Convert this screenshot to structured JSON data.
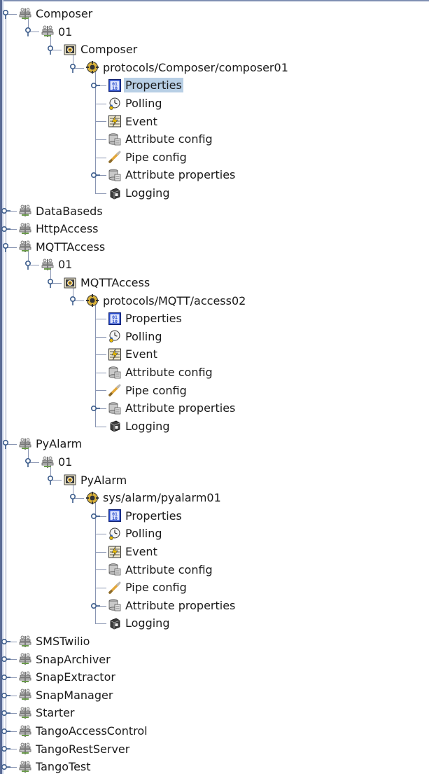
{
  "tree": {
    "rows": [
      {
        "depth": 0,
        "label": "Composer",
        "icon": "server-class-icon",
        "state": "expanded"
      },
      {
        "depth": 1,
        "label": "01",
        "icon": "server-class-icon",
        "state": "expanded"
      },
      {
        "depth": 2,
        "label": "Composer",
        "icon": "device-class-icon",
        "state": "expanded"
      },
      {
        "depth": 3,
        "label": "protocols/Composer/composer01",
        "icon": "device-icon",
        "state": "expanded"
      },
      {
        "depth": 4,
        "label": "Properties",
        "icon": "properties-icon",
        "state": "collapsed",
        "selected": true
      },
      {
        "depth": 4,
        "label": "Polling",
        "icon": "polling-icon",
        "state": "leaf"
      },
      {
        "depth": 4,
        "label": "Event",
        "icon": "event-icon",
        "state": "leaf"
      },
      {
        "depth": 4,
        "label": "Attribute config",
        "icon": "attribute-config-icon",
        "state": "leaf"
      },
      {
        "depth": 4,
        "label": "Pipe config",
        "icon": "pipe-config-icon",
        "state": "leaf"
      },
      {
        "depth": 4,
        "label": "Attribute properties",
        "icon": "attribute-config-icon",
        "state": "collapsed"
      },
      {
        "depth": 4,
        "label": "Logging",
        "icon": "logging-icon",
        "state": "leaf",
        "last": true
      },
      {
        "depth": 0,
        "label": "DataBaseds",
        "icon": "server-class-icon",
        "state": "collapsed"
      },
      {
        "depth": 0,
        "label": "HttpAccess",
        "icon": "server-class-icon",
        "state": "collapsed"
      },
      {
        "depth": 0,
        "label": "MQTTAccess",
        "icon": "server-class-icon",
        "state": "expanded"
      },
      {
        "depth": 1,
        "label": "01",
        "icon": "server-class-icon",
        "state": "expanded"
      },
      {
        "depth": 2,
        "label": "MQTTAccess",
        "icon": "device-class-icon",
        "state": "expanded"
      },
      {
        "depth": 3,
        "label": "protocols/MQTT/access02",
        "icon": "device-icon",
        "state": "expanded"
      },
      {
        "depth": 4,
        "label": "Properties",
        "icon": "properties-icon",
        "state": "leaf"
      },
      {
        "depth": 4,
        "label": "Polling",
        "icon": "polling-icon",
        "state": "leaf"
      },
      {
        "depth": 4,
        "label": "Event",
        "icon": "event-icon",
        "state": "leaf"
      },
      {
        "depth": 4,
        "label": "Attribute config",
        "icon": "attribute-config-icon",
        "state": "leaf"
      },
      {
        "depth": 4,
        "label": "Pipe config",
        "icon": "pipe-config-icon",
        "state": "leaf"
      },
      {
        "depth": 4,
        "label": "Attribute properties",
        "icon": "attribute-config-icon",
        "state": "collapsed"
      },
      {
        "depth": 4,
        "label": "Logging",
        "icon": "logging-icon",
        "state": "leaf",
        "last": true
      },
      {
        "depth": 0,
        "label": "PyAlarm",
        "icon": "server-class-icon",
        "state": "expanded"
      },
      {
        "depth": 1,
        "label": "01",
        "icon": "server-class-icon",
        "state": "expanded"
      },
      {
        "depth": 2,
        "label": "PyAlarm",
        "icon": "device-class-icon",
        "state": "expanded"
      },
      {
        "depth": 3,
        "label": "sys/alarm/pyalarm01",
        "icon": "device-icon",
        "state": "expanded"
      },
      {
        "depth": 4,
        "label": "Properties",
        "icon": "properties-icon",
        "state": "collapsed"
      },
      {
        "depth": 4,
        "label": "Polling",
        "icon": "polling-icon",
        "state": "leaf"
      },
      {
        "depth": 4,
        "label": "Event",
        "icon": "event-icon",
        "state": "leaf"
      },
      {
        "depth": 4,
        "label": "Attribute config",
        "icon": "attribute-config-icon",
        "state": "leaf"
      },
      {
        "depth": 4,
        "label": "Pipe config",
        "icon": "pipe-config-icon",
        "state": "leaf"
      },
      {
        "depth": 4,
        "label": "Attribute properties",
        "icon": "attribute-config-icon",
        "state": "collapsed"
      },
      {
        "depth": 4,
        "label": "Logging",
        "icon": "logging-icon",
        "state": "leaf",
        "last": true
      },
      {
        "depth": 0,
        "label": "SMSTwilio",
        "icon": "server-class-icon",
        "state": "collapsed"
      },
      {
        "depth": 0,
        "label": "SnapArchiver",
        "icon": "server-class-icon",
        "state": "collapsed"
      },
      {
        "depth": 0,
        "label": "SnapExtractor",
        "icon": "server-class-icon",
        "state": "collapsed"
      },
      {
        "depth": 0,
        "label": "SnapManager",
        "icon": "server-class-icon",
        "state": "collapsed"
      },
      {
        "depth": 0,
        "label": "Starter",
        "icon": "server-class-icon",
        "state": "collapsed"
      },
      {
        "depth": 0,
        "label": "TangoAccessControl",
        "icon": "server-class-icon",
        "state": "collapsed"
      },
      {
        "depth": 0,
        "label": "TangoRestServer",
        "icon": "server-class-icon",
        "state": "collapsed"
      },
      {
        "depth": 0,
        "label": "TangoTest",
        "icon": "server-class-icon",
        "state": "collapsed"
      }
    ]
  },
  "colors": {
    "selection": "#b8cfe5",
    "tree_line": "#8a96b3",
    "handle": "#3d5d8c",
    "border": "#5a6b95"
  }
}
